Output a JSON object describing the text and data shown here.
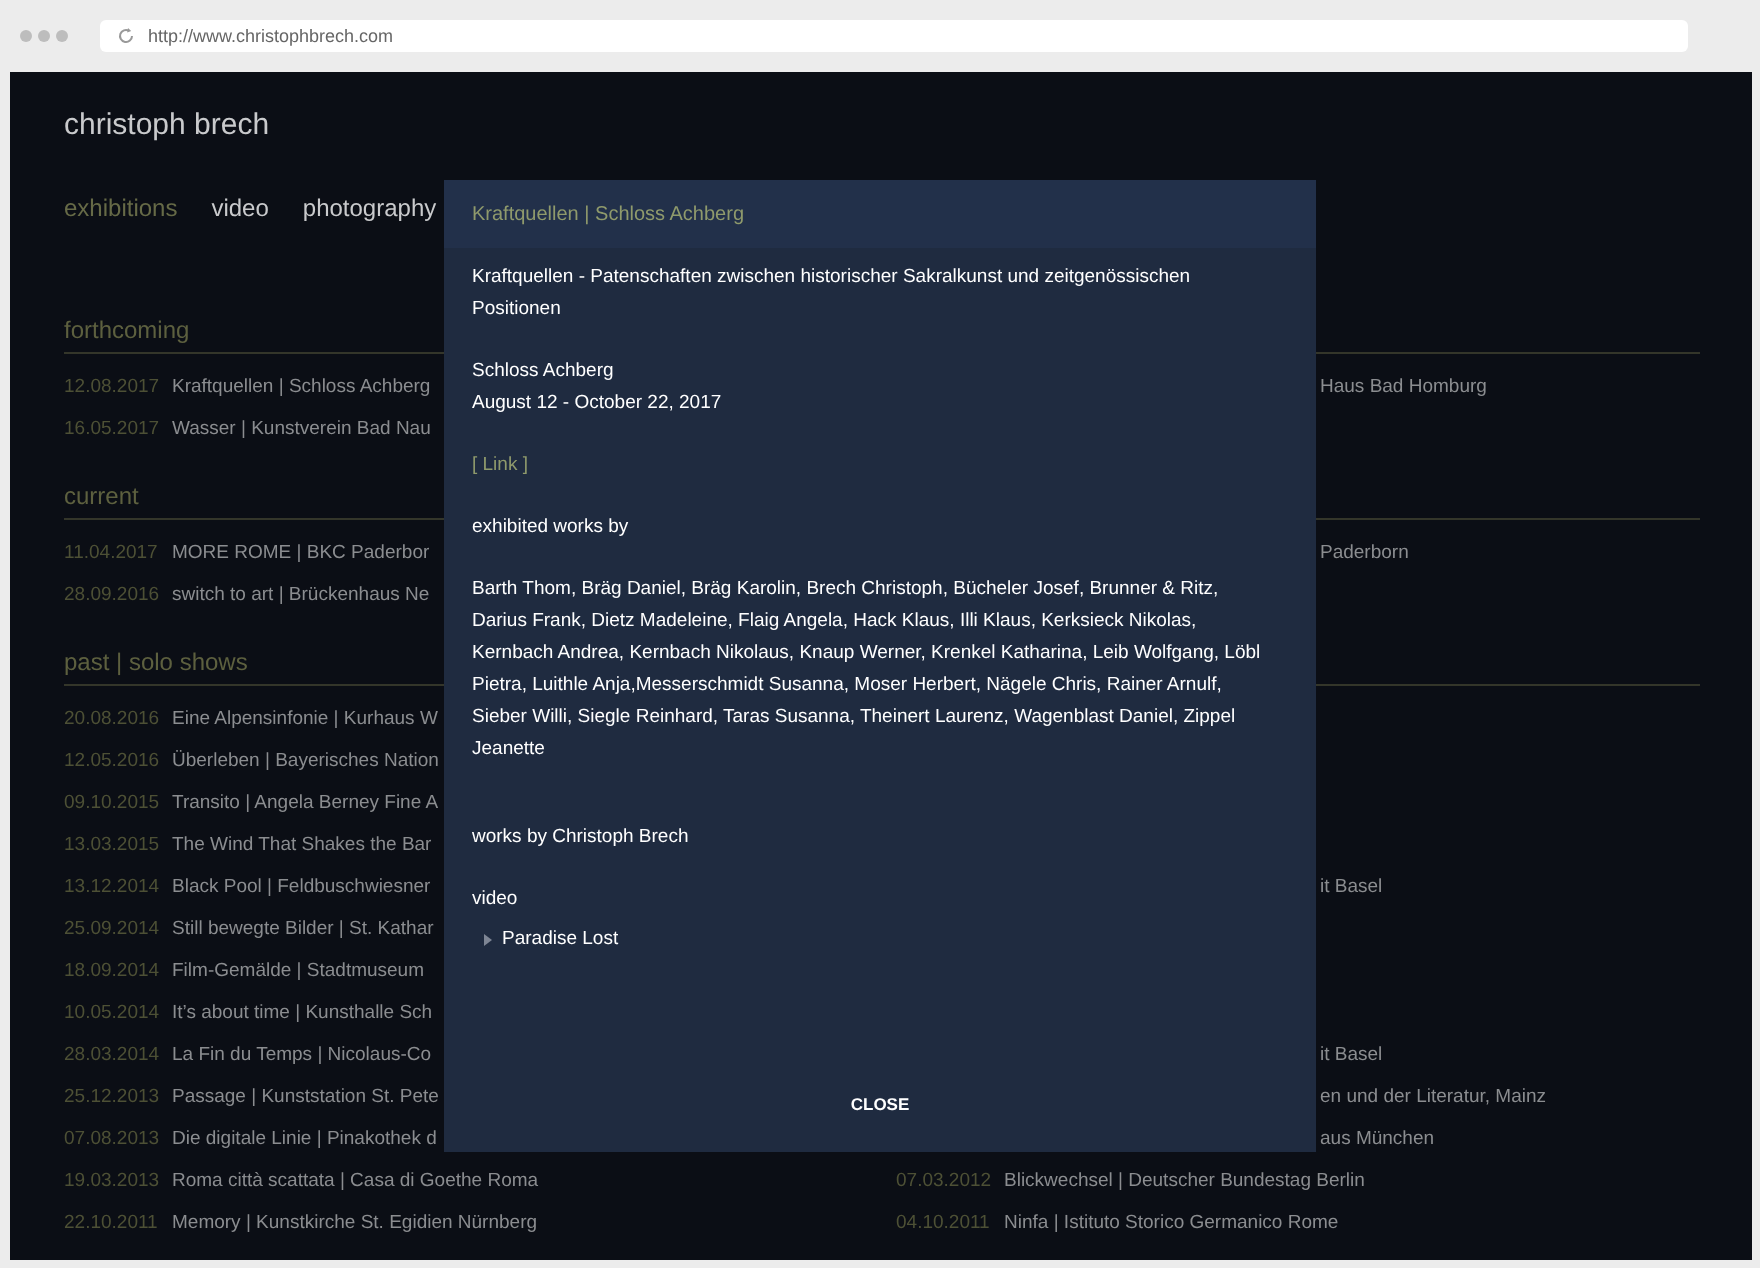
{
  "browser": {
    "url": "http://www.christophbrech.com"
  },
  "site": {
    "title": "christoph brech",
    "nav": [
      {
        "label": "exhibitions",
        "selected": true
      },
      {
        "label": "video",
        "selected": false
      },
      {
        "label": "photography",
        "selected": false
      }
    ]
  },
  "sections": [
    {
      "heading": "forthcoming",
      "rows": [
        {
          "date": "12.08.2017",
          "title": "Kraftquellen | Schloss Achberg",
          "right": {
            "title": "Haus Bad Homburg"
          }
        },
        {
          "date": "16.05.2017",
          "title": "Wasser | Kunstverein Bad Nau"
        }
      ]
    },
    {
      "heading": "current",
      "rows": [
        {
          "date": "11.04.2017",
          "title": "MORE ROME | BKC Paderbor",
          "right": {
            "title": "Paderborn"
          }
        },
        {
          "date": "28.09.2016",
          "title": "switch to art | Brückenhaus Ne"
        }
      ]
    },
    {
      "heading": "past | solo shows",
      "rows": [
        {
          "date": "20.08.2016",
          "title": "Eine Alpensinfonie | Kurhaus W"
        },
        {
          "date": "12.05.2016",
          "title": "Überleben | Bayerisches Nation"
        },
        {
          "date": "09.10.2015",
          "title": "Transito | Angela Berney Fine A"
        },
        {
          "date": "13.03.2015",
          "title": "The Wind That Shakes the Bar"
        },
        {
          "date": "13.12.2014",
          "title": "Black Pool | Feldbuschwiesner",
          "right": {
            "title": "it Basel"
          }
        },
        {
          "date": "25.09.2014",
          "title": "Still bewegte Bilder | St. Kathar"
        },
        {
          "date": "18.09.2014",
          "title": "Film-Gemälde | Stadtmuseum"
        },
        {
          "date": "10.05.2014",
          "title": "It’s about time | Kunsthalle Sch"
        },
        {
          "date": "28.03.2014",
          "title": "La Fin du Temps | Nicolaus-Co",
          "right": {
            "title": "it Basel"
          }
        },
        {
          "date": "25.12.2013",
          "title": "Passage | Kunststation St. Pete",
          "right": {
            "title": "en und der Literatur, Mainz"
          }
        },
        {
          "date": "07.08.2013",
          "title": "Die digitale Linie | Pinakothek d",
          "right": {
            "title": "aus München"
          }
        },
        {
          "date": "19.03.2013",
          "title": "Roma città scattata | Casa di Goethe Roma",
          "right": {
            "date": "07.03.2012",
            "title": "Blickwechsel | Deutscher Bundestag Berlin"
          }
        },
        {
          "date": "22.10.2011",
          "title": "Memory | Kunstkirche St. Egidien Nürnberg",
          "right": {
            "date": "04.10.2011",
            "title": "Ninfa | Istituto Storico Germanico Rome"
          }
        }
      ]
    }
  ],
  "modal": {
    "title": "Kraftquellen | Schloss Achberg",
    "description": "Kraftquellen - Patenschaften zwischen historischer Sakralkunst und zeitgenössischen Positionen",
    "venue": "Schloss Achberg",
    "dates": "August 12 - October 22, 2017",
    "link": "[ Link ]",
    "artists_heading": "exhibited works by",
    "artists": "Barth Thom, Bräg Daniel, Bräg Karolin, Brech Christoph, Bücheler Josef, Brunner & Ritz, Darius Frank, Dietz Madeleine, Flaig Angela, Hack Klaus, Illi Klaus, Kerksieck Nikolas, Kernbach Andrea, Kernbach Nikolaus, Knaup Werner, Krenkel Katharina, Leib Wolfgang, Löbl Pietra, Luithle Anja,Messerschmidt Susanna, Moser Herbert, Nägele Chris, Rainer Arnulf, Sieber Willi, Siegle Reinhard, Taras Susanna, Theinert Laurenz, Wagenblast Daniel, Zippel Jeanette",
    "works_heading": "works by Christoph Brech",
    "category": "video",
    "works": [
      "Paradise Lost"
    ],
    "close": "CLOSE"
  }
}
